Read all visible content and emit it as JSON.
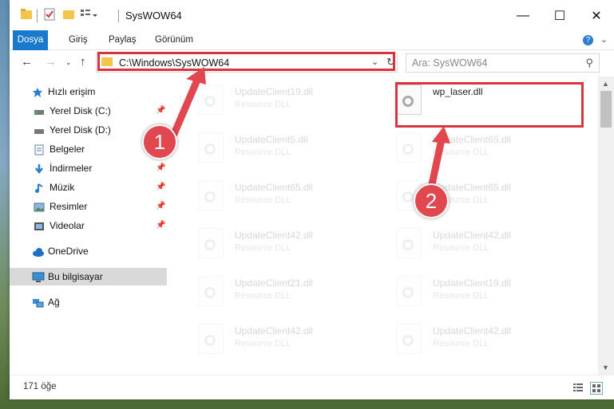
{
  "window": {
    "title": "SysWOW64",
    "minimize_glyph": "—",
    "maximize_glyph": "☐",
    "close_glyph": "✕"
  },
  "ribbon": {
    "tabs": [
      "Dosya",
      "Giriş",
      "Paylaş",
      "Görünüm"
    ]
  },
  "nav": {
    "address": "C:\\Windows\\SysWOW64",
    "search_placeholder": "Ara: SysWOW64"
  },
  "sidebar": {
    "items": [
      {
        "label": "Hızlı erişim",
        "icon": "star-icon",
        "pinned": false
      },
      {
        "label": "Yerel Disk (C:)",
        "icon": "drive-icon",
        "pinned": true
      },
      {
        "label": "Yerel Disk (D:)",
        "icon": "drive-icon",
        "pinned": true
      },
      {
        "label": "Belgeler",
        "icon": "documents-icon",
        "pinned": true
      },
      {
        "label": "İndirmeler",
        "icon": "download-icon",
        "pinned": true
      },
      {
        "label": "Müzik",
        "icon": "music-icon",
        "pinned": true
      },
      {
        "label": "Resimler",
        "icon": "pictures-icon",
        "pinned": true
      },
      {
        "label": "Videolar",
        "icon": "videos-icon",
        "pinned": true
      },
      {
        "label": "OneDrive",
        "icon": "cloud-icon",
        "pinned": false
      },
      {
        "label": "Bu bilgisayar",
        "icon": "computer-icon",
        "pinned": false,
        "selected": true
      },
      {
        "label": "Ağ",
        "icon": "network-icon",
        "pinned": false
      }
    ]
  },
  "files": {
    "left": [
      {
        "name": "UpdateClient19.dll",
        "type": "Resource DLL"
      },
      {
        "name": "UpdateClient5.dll",
        "type": "Resource DLL"
      },
      {
        "name": "UpdateClient65.dll",
        "type": "Resource DLL"
      },
      {
        "name": "UpdateClient42.dll",
        "type": "Resource DLL"
      },
      {
        "name": "UpdateClient21.dll",
        "type": "Resource DLL"
      },
      {
        "name": "UpdateClient42.dll",
        "type": "Resource DLL"
      }
    ],
    "right": [
      {
        "name": "wp_laser.dll",
        "type": "",
        "highlighted": true
      },
      {
        "name": "UpdateClient65.dll",
        "type": "Resource DLL"
      },
      {
        "name": "UpdateClient65.dll",
        "type": "Resource DLL"
      },
      {
        "name": "UpdateClient42.dll",
        "type": "Resource DLL"
      },
      {
        "name": "UpdateClient19.dll",
        "type": "Resource DLL"
      },
      {
        "name": "UpdateClient42.dll",
        "type": "Resource DLL"
      }
    ]
  },
  "status": {
    "count_text": "171 öğe"
  },
  "annotations": {
    "marker_1": "1",
    "marker_2": "2",
    "color": "#d9333f"
  }
}
